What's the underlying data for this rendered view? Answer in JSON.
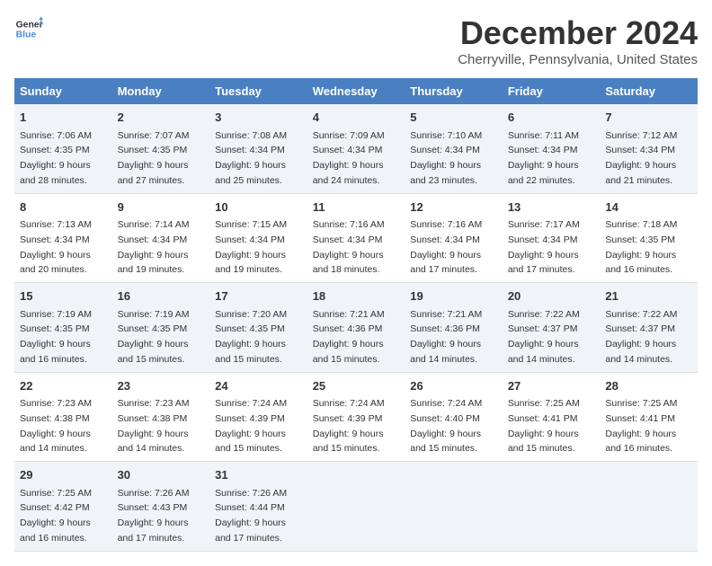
{
  "logo": {
    "line1": "General",
    "line2": "Blue"
  },
  "title": "December 2024",
  "location": "Cherryville, Pennsylvania, United States",
  "days_of_week": [
    "Sunday",
    "Monday",
    "Tuesday",
    "Wednesday",
    "Thursday",
    "Friday",
    "Saturday"
  ],
  "weeks": [
    [
      {
        "day": "1",
        "sunrise": "7:06 AM",
        "sunset": "4:35 PM",
        "daylight": "9 hours and 28 minutes."
      },
      {
        "day": "2",
        "sunrise": "7:07 AM",
        "sunset": "4:35 PM",
        "daylight": "9 hours and 27 minutes."
      },
      {
        "day": "3",
        "sunrise": "7:08 AM",
        "sunset": "4:34 PM",
        "daylight": "9 hours and 25 minutes."
      },
      {
        "day": "4",
        "sunrise": "7:09 AM",
        "sunset": "4:34 PM",
        "daylight": "9 hours and 24 minutes."
      },
      {
        "day": "5",
        "sunrise": "7:10 AM",
        "sunset": "4:34 PM",
        "daylight": "9 hours and 23 minutes."
      },
      {
        "day": "6",
        "sunrise": "7:11 AM",
        "sunset": "4:34 PM",
        "daylight": "9 hours and 22 minutes."
      },
      {
        "day": "7",
        "sunrise": "7:12 AM",
        "sunset": "4:34 PM",
        "daylight": "9 hours and 21 minutes."
      }
    ],
    [
      {
        "day": "8",
        "sunrise": "7:13 AM",
        "sunset": "4:34 PM",
        "daylight": "9 hours and 20 minutes."
      },
      {
        "day": "9",
        "sunrise": "7:14 AM",
        "sunset": "4:34 PM",
        "daylight": "9 hours and 19 minutes."
      },
      {
        "day": "10",
        "sunrise": "7:15 AM",
        "sunset": "4:34 PM",
        "daylight": "9 hours and 19 minutes."
      },
      {
        "day": "11",
        "sunrise": "7:16 AM",
        "sunset": "4:34 PM",
        "daylight": "9 hours and 18 minutes."
      },
      {
        "day": "12",
        "sunrise": "7:16 AM",
        "sunset": "4:34 PM",
        "daylight": "9 hours and 17 minutes."
      },
      {
        "day": "13",
        "sunrise": "7:17 AM",
        "sunset": "4:34 PM",
        "daylight": "9 hours and 17 minutes."
      },
      {
        "day": "14",
        "sunrise": "7:18 AM",
        "sunset": "4:35 PM",
        "daylight": "9 hours and 16 minutes."
      }
    ],
    [
      {
        "day": "15",
        "sunrise": "7:19 AM",
        "sunset": "4:35 PM",
        "daylight": "9 hours and 16 minutes."
      },
      {
        "day": "16",
        "sunrise": "7:19 AM",
        "sunset": "4:35 PM",
        "daylight": "9 hours and 15 minutes."
      },
      {
        "day": "17",
        "sunrise": "7:20 AM",
        "sunset": "4:35 PM",
        "daylight": "9 hours and 15 minutes."
      },
      {
        "day": "18",
        "sunrise": "7:21 AM",
        "sunset": "4:36 PM",
        "daylight": "9 hours and 15 minutes."
      },
      {
        "day": "19",
        "sunrise": "7:21 AM",
        "sunset": "4:36 PM",
        "daylight": "9 hours and 14 minutes."
      },
      {
        "day": "20",
        "sunrise": "7:22 AM",
        "sunset": "4:37 PM",
        "daylight": "9 hours and 14 minutes."
      },
      {
        "day": "21",
        "sunrise": "7:22 AM",
        "sunset": "4:37 PM",
        "daylight": "9 hours and 14 minutes."
      }
    ],
    [
      {
        "day": "22",
        "sunrise": "7:23 AM",
        "sunset": "4:38 PM",
        "daylight": "9 hours and 14 minutes."
      },
      {
        "day": "23",
        "sunrise": "7:23 AM",
        "sunset": "4:38 PM",
        "daylight": "9 hours and 14 minutes."
      },
      {
        "day": "24",
        "sunrise": "7:24 AM",
        "sunset": "4:39 PM",
        "daylight": "9 hours and 15 minutes."
      },
      {
        "day": "25",
        "sunrise": "7:24 AM",
        "sunset": "4:39 PM",
        "daylight": "9 hours and 15 minutes."
      },
      {
        "day": "26",
        "sunrise": "7:24 AM",
        "sunset": "4:40 PM",
        "daylight": "9 hours and 15 minutes."
      },
      {
        "day": "27",
        "sunrise": "7:25 AM",
        "sunset": "4:41 PM",
        "daylight": "9 hours and 15 minutes."
      },
      {
        "day": "28",
        "sunrise": "7:25 AM",
        "sunset": "4:41 PM",
        "daylight": "9 hours and 16 minutes."
      }
    ],
    [
      {
        "day": "29",
        "sunrise": "7:25 AM",
        "sunset": "4:42 PM",
        "daylight": "9 hours and 16 minutes."
      },
      {
        "day": "30",
        "sunrise": "7:26 AM",
        "sunset": "4:43 PM",
        "daylight": "9 hours and 17 minutes."
      },
      {
        "day": "31",
        "sunrise": "7:26 AM",
        "sunset": "4:44 PM",
        "daylight": "9 hours and 17 minutes."
      },
      null,
      null,
      null,
      null
    ]
  ],
  "labels": {
    "sunrise": "Sunrise:",
    "sunset": "Sunset:",
    "daylight": "Daylight:"
  }
}
